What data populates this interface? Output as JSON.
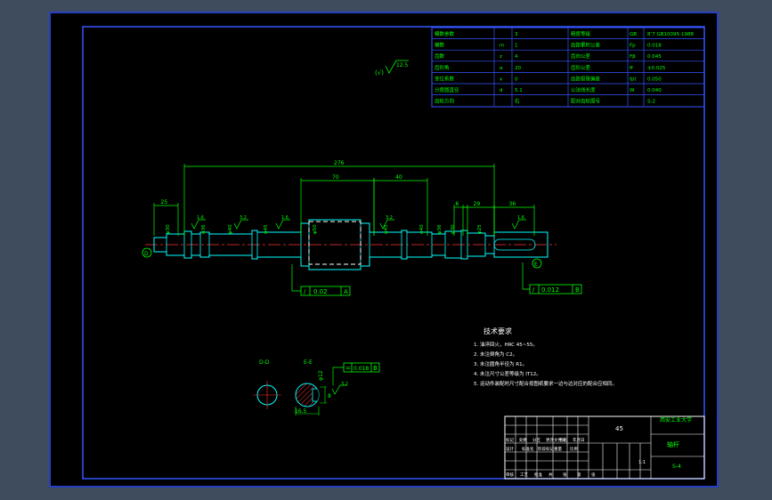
{
  "colors": {
    "background_outer": "#3f4c5e",
    "paper": "#000000",
    "frame": "#3355ff",
    "dimension": "#00ff00",
    "outline": "#00ffff",
    "centerline": "#ff3333",
    "keyway": "#ffffff"
  },
  "param_table": {
    "rows": [
      {
        "label": "模数参数",
        "sym": "",
        "val": "3",
        "label2": "精度等级",
        "sym2": "GB",
        "val2": "8’7 GB10095-1988"
      },
      {
        "label": "模数",
        "sym": "m",
        "val": "1",
        "label2": "齿距累积公差",
        "sym2": "Fp",
        "val2": "0.018"
      },
      {
        "label": "齿数",
        "sym": "z",
        "val": "4",
        "label2": "齿向公差",
        "sym2": "Fβ",
        "val2": "0.045"
      },
      {
        "label": "齿形角",
        "sym": "α",
        "val": "20",
        "label2": "齿形公差",
        "sym2": "ff",
        "val2": "±0.025"
      },
      {
        "label": "变位系数",
        "sym": "x",
        "val": "0",
        "label2": "齿距极限偏差",
        "sym2": "fpt",
        "val2": "0.050"
      },
      {
        "label": "分度圆直径",
        "sym": "d",
        "val": "5.1",
        "label2": "公法线长度",
        "sym2": "W",
        "val2": "0.040"
      },
      {
        "label": "齿轮方向",
        "sym": "",
        "val": "右",
        "label2": "配对齿轮图号",
        "sym2": "",
        "val2": "S-2"
      }
    ]
  },
  "roughness_general": {
    "symbol": "√",
    "value": "12.5",
    "note": "(√)"
  },
  "dimensions": {
    "overall_length": "276",
    "center_length": "70",
    "right_length": "40",
    "left_length": "25",
    "right_segment": "29",
    "end_segment": "36",
    "small_segment": "6",
    "labels": [
      "φ30",
      "φ36",
      "φ40",
      "φ45",
      "φ50",
      "φ45",
      "φ40",
      "φ36",
      "φ30",
      "φ25"
    ],
    "roughness": [
      "1.6",
      "3.2",
      "1.6",
      "3.2",
      "1.6"
    ]
  },
  "tolerance_frames": [
    {
      "symbol": "/",
      "value": "0.02",
      "datum": "A"
    },
    {
      "symbol": "/",
      "value": "0.012",
      "datum": "B"
    },
    {
      "symbol": "=",
      "value": "0.018",
      "datum": "B"
    }
  ],
  "section_views": {
    "left_label": "D-D",
    "right_label": "E-E",
    "dim_width": "16.5",
    "dim_depth": "8",
    "dim_key": "φ12",
    "roughness": "3.2"
  },
  "tech_req": {
    "title": "技术要求",
    "items": [
      "1. 油淬回火，HRC 45~55。",
      "2. 未注倒角为 C2。",
      "3. 未注圆角半径为 R1。",
      "4. 未注尺寸公差等级为 IT12。",
      "5. 运动件装配时尺寸配合按图纸要求一边与边对应的配合应相同。"
    ]
  },
  "title_block": {
    "material": "45",
    "school": "西安工业大学",
    "part_name": "轴杆",
    "drawing_no": "S-4",
    "scale": "1:1",
    "row_labels": [
      "标记",
      "处数",
      "分区",
      "更改文件号",
      "签名",
      "年月日"
    ],
    "row_labels2": [
      "设计",
      "标准化",
      "阶段标记",
      "重量",
      "比例"
    ],
    "row_labels3": [
      "审核",
      "工艺",
      "批准",
      "共",
      "张",
      "第",
      "张"
    ]
  }
}
